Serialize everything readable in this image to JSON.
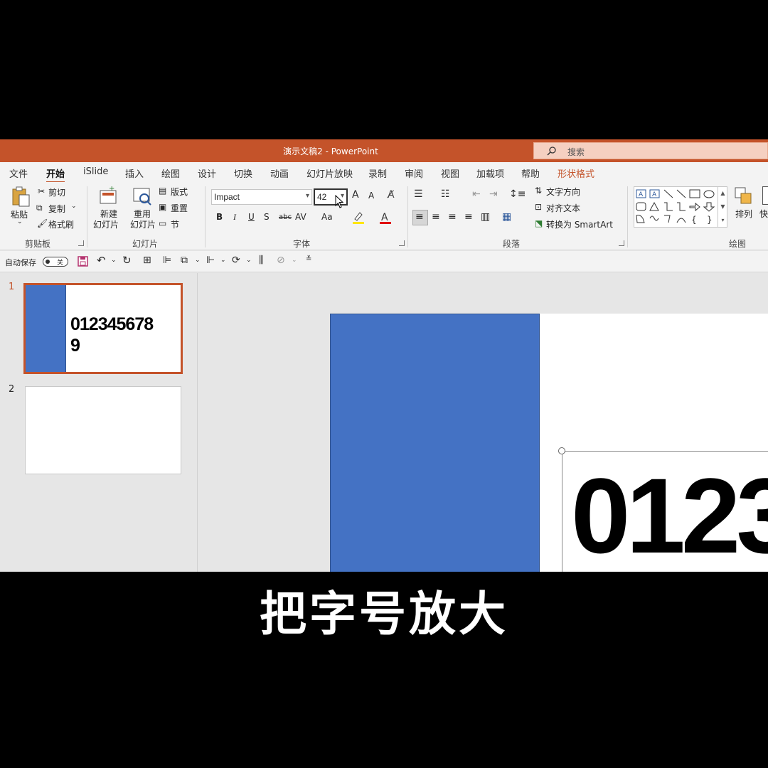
{
  "window": {
    "title": "演示文稿2  -  PowerPoint",
    "search_placeholder": "搜索"
  },
  "tabs": [
    "文件",
    "开始",
    "iSlide",
    "插入",
    "绘图",
    "设计",
    "切换",
    "动画",
    "幻灯片放映",
    "录制",
    "审阅",
    "视图",
    "加载项",
    "帮助",
    "形状格式"
  ],
  "active_tab": "开始",
  "clipboard": {
    "paste": "粘贴",
    "cut": "剪切",
    "copy": "复制",
    "format_painter": "格式刷",
    "label": "剪贴板"
  },
  "slides_group": {
    "new_slide": "新建",
    "new_slide2": "幻灯片",
    "reuse": "重用",
    "reuse2": "幻灯片",
    "layout": "版式",
    "reset": "重置",
    "section": "节",
    "label": "幻灯片"
  },
  "font": {
    "name": "Impact",
    "size": "42",
    "label": "字体",
    "bold": "B",
    "italic": "I",
    "underline": "U",
    "shadow": "S",
    "strike": "abc",
    "spacing": "AV",
    "case": "Aa",
    "grow": "A",
    "shrink": "A"
  },
  "paragraph": {
    "text_direction": "文字方向",
    "align_text": "对齐文本",
    "smartart": "转换为 SmartArt",
    "label": "段落"
  },
  "drawing": {
    "arrange": "排列",
    "quick": "快",
    "label": "绘图"
  },
  "qat": {
    "autosave": "自动保存",
    "autosave_state": "关"
  },
  "slides": [
    {
      "number": "1",
      "text_line1": "012345678",
      "text_line2": "9"
    },
    {
      "number": "2"
    }
  ],
  "slide_main": {
    "text": "0123"
  },
  "colors": {
    "accent": "#c4532a",
    "shape_blue": "#4472c4"
  },
  "subtitle": "把字号放大"
}
